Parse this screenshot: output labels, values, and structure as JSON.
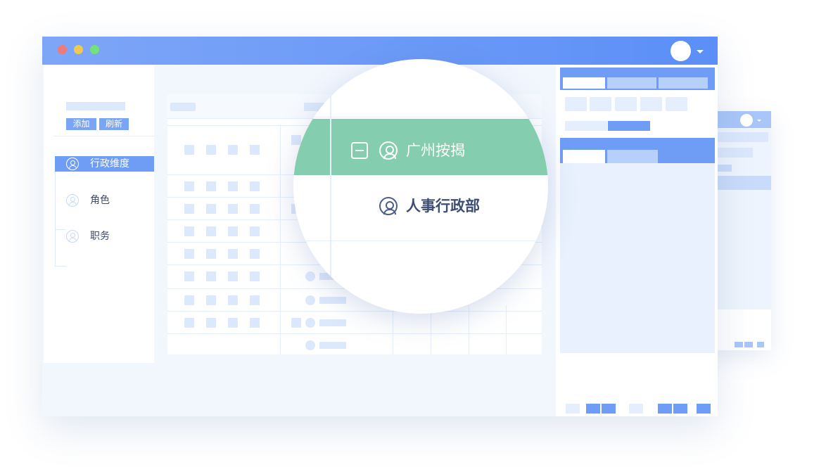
{
  "window": {
    "traffic_lights": [
      "#ee7a7a",
      "#f2c84e",
      "#74e27a"
    ],
    "titlebar_color": "#6f9cf7"
  },
  "toolbar": {
    "add_label": "添加",
    "refresh_label": "刷新"
  },
  "tree": {
    "items": [
      {
        "label": "行政维度",
        "selected": true
      },
      {
        "label": "角色",
        "selected": false
      },
      {
        "label": "职务",
        "selected": false
      }
    ]
  },
  "magnifier": {
    "expanded_row": {
      "label": "广州按揭",
      "highlight": "#84cdae"
    },
    "child_row": {
      "label": "人事行政部"
    }
  },
  "icons": [
    "user-circle-icon",
    "collapse-square-icon",
    "avatar",
    "chevron-down-icon"
  ]
}
